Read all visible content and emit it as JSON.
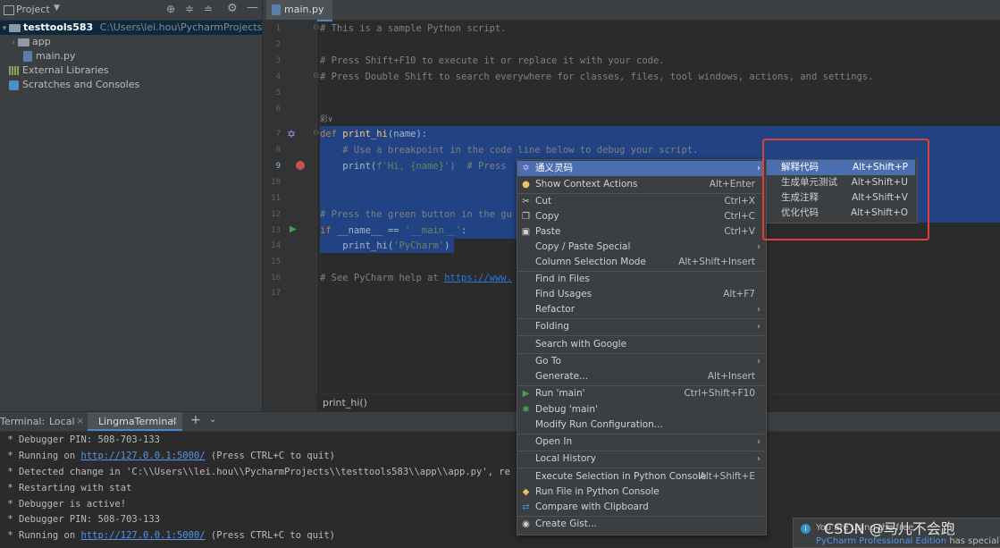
{
  "project_panel": {
    "title": "Project",
    "root_name": "testtools583",
    "root_path": "C:\\Users\\lei.hou\\PycharmProjects\\testtools5",
    "items": [
      {
        "label": "app"
      },
      {
        "label": "main.py"
      },
      {
        "label": "External Libraries"
      },
      {
        "label": "Scratches and Consoles"
      }
    ]
  },
  "editor": {
    "tab_label": "main.py",
    "breadcrumb": "print_hi()",
    "line_numbers": [
      "1",
      "2",
      "3",
      "4",
      "5",
      "6",
      "7",
      "8",
      "9",
      "10",
      "11",
      "12",
      "13",
      "14",
      "15",
      "16",
      "17"
    ],
    "lines": {
      "l1": "# This is a sample Python script.",
      "l3": "# Press Shift+F10 to execute it or replace it with your code.",
      "l4": "# Press Double Shift to search everywhere for classes, files, tool windows, actions, and settings.",
      "l6_hint": "彩∨",
      "l7_kw": "def ",
      "l7_fn": "print_hi",
      "l7_rest": "(name):",
      "l8": "    # Use a breakpoint in the code line below to debug your script.",
      "l9_a": "    print(",
      "l9_b": "f'Hi, {name}'",
      "l9_c": ")  # Press",
      "l12": "# Press the green button in the gu",
      "l13_kw": "if ",
      "l13_a": "__name__ == ",
      "l13_b": "'__main__'",
      "l13_c": ":",
      "l14_a": "    print_hi(",
      "l14_b": "'PyCharm'",
      "l14_c": ")",
      "l16_a": "# See PyCharm help at ",
      "l16_b": "https://www."
    }
  },
  "terminal": {
    "label": "Terminal:",
    "tabs": [
      "Local",
      "LingmaTerminal"
    ],
    "add": "+",
    "lines": [
      {
        "text": " * Debugger PIN: 508-703-133"
      },
      {
        "pre": " * Running on ",
        "link": "http://127.0.0.1:5000/",
        "post": " (Press CTRL+C to quit)"
      },
      {
        "text": " * Detected change in 'C:\\\\Users\\\\lei.hou\\\\PycharmProjects\\\\testtools583\\\\app\\\\app.py', re"
      },
      {
        "text": " * Restarting with stat"
      },
      {
        "text": " * Debugger is active!"
      },
      {
        "text": " * Debugger PIN: 508-703-133"
      },
      {
        "pre": " * Running on ",
        "link": "http://127.0.0.1:5000/",
        "post": " (Press CTRL+C to quit)"
      }
    ]
  },
  "context_menu": {
    "items": [
      {
        "label": "通义灵码",
        "shortcut": "",
        "submenu": true
      },
      {
        "label": "Show Context Actions",
        "shortcut": "Alt+Enter"
      },
      {
        "label": "Cut",
        "shortcut": "Ctrl+X"
      },
      {
        "label": "Copy",
        "shortcut": "Ctrl+C"
      },
      {
        "label": "Paste",
        "shortcut": "Ctrl+V"
      },
      {
        "label": "Copy / Paste Special",
        "shortcut": "",
        "submenu": true
      },
      {
        "label": "Column Selection Mode",
        "shortcut": "Alt+Shift+Insert"
      },
      {
        "label": "Find in Files",
        "shortcut": ""
      },
      {
        "label": "Find Usages",
        "shortcut": "Alt+F7"
      },
      {
        "label": "Refactor",
        "shortcut": "",
        "submenu": true
      },
      {
        "label": "Folding",
        "shortcut": "",
        "submenu": true
      },
      {
        "label": "Search with Google",
        "shortcut": ""
      },
      {
        "label": "Go To",
        "shortcut": "",
        "submenu": true
      },
      {
        "label": "Generate...",
        "shortcut": "Alt+Insert"
      },
      {
        "label": "Run 'main'",
        "shortcut": "Ctrl+Shift+F10"
      },
      {
        "label": "Debug 'main'",
        "shortcut": ""
      },
      {
        "label": "Modify Run Configuration...",
        "shortcut": ""
      },
      {
        "label": "Open In",
        "shortcut": "",
        "submenu": true
      },
      {
        "label": "Local History",
        "shortcut": "",
        "submenu": true
      },
      {
        "label": "Execute Selection in Python Console",
        "shortcut": "Alt+Shift+E"
      },
      {
        "label": "Run File in Python Console",
        "shortcut": ""
      },
      {
        "label": "Compare with Clipboard",
        "shortcut": ""
      },
      {
        "label": "Create Gist...",
        "shortcut": ""
      }
    ]
  },
  "submenu": {
    "items": [
      {
        "label": "解释代码",
        "shortcut": "Alt+Shift+P"
      },
      {
        "label": "生成单元测试",
        "shortcut": "Alt+Shift+U"
      },
      {
        "label": "生成注释",
        "shortcut": "Alt+Shift+V"
      },
      {
        "label": "优化代码",
        "shortcut": "Alt+Shift+O"
      }
    ]
  },
  "notification": {
    "line1": "You are using the free",
    "line2a": "PyCharm Professional Edition",
    "line2b": " has special"
  },
  "watermark": "CSDN @马儿不会跑",
  "colors": {
    "accent": "#4b6eaf",
    "selection": "#214283",
    "annotation_box": "#e0403a"
  }
}
